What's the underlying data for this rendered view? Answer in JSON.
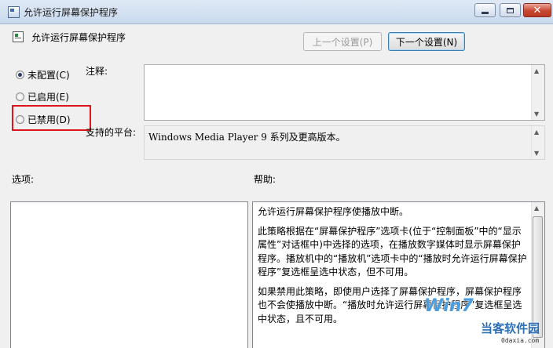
{
  "window": {
    "title": "允许运行屏幕保护程序",
    "controls": {
      "minimize": "minimize",
      "maximize": "maximize",
      "close": "✕"
    }
  },
  "header": {
    "title": "允许运行屏幕保护程序",
    "prev_button": "上一个设置(P)",
    "next_button": "下一个设置(N)"
  },
  "state_options": [
    {
      "label": "未配置(C)",
      "checked": true
    },
    {
      "label": "已启用(E)",
      "checked": false
    },
    {
      "label": "已禁用(D)",
      "checked": false
    }
  ],
  "comment": {
    "label": "注释:",
    "value": ""
  },
  "platform": {
    "label": "支持的平台:",
    "value": "Windows Media Player 9 系列及更高版本。"
  },
  "options": {
    "label": "选项:"
  },
  "help": {
    "label": "帮助:",
    "paragraphs": [
      "允许运行屏幕保护程序使播放中断。",
      "此策略根据在“屏幕保护程序”选项卡(位于“控制面板”中的“显示属性”对话框中)中选择的选项，在播放数字媒体时显示屏幕保护程序。播放机中的“播放机”选项卡中的“播放时允许运行屏幕保护程序”复选框呈选中状态，但不可用。",
      "如果禁用此策略，即使用户选择了屏幕保护程序，屏幕保护程序也不会使播放中断。“播放时允许运行屏幕保护程序”复选框呈选中状态，且不可用。"
    ]
  },
  "watermark": {
    "logo": "Win7",
    "site": "当客软件园",
    "url": "0daxia.com"
  },
  "colors": {
    "highlight_border": "#e0141b",
    "titlebar": "#c9daee",
    "background": "#f0f0f0"
  }
}
